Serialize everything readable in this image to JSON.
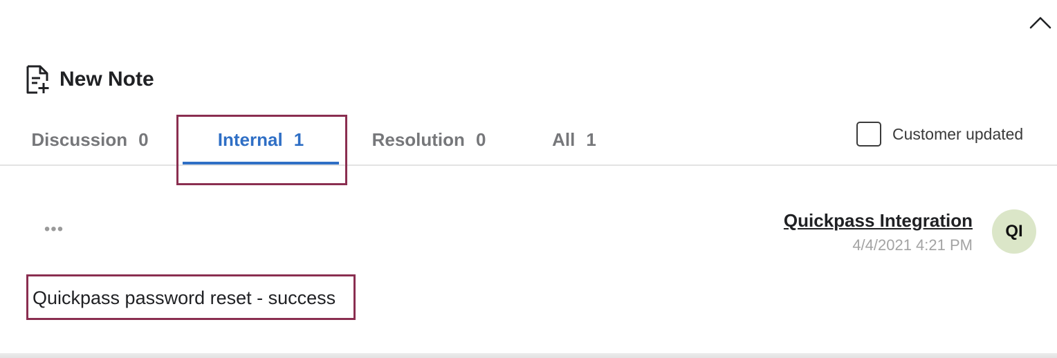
{
  "header": {
    "collapse_icon": "chevron-up-icon",
    "new_note_icon": "note-add-icon",
    "new_note_label": "New Note"
  },
  "tabs": [
    {
      "label": "Discussion",
      "count": "0",
      "active": false
    },
    {
      "label": "Internal",
      "count": "1",
      "active": true
    },
    {
      "label": "Resolution",
      "count": "0",
      "active": false
    },
    {
      "label": "All",
      "count": "1",
      "active": false
    }
  ],
  "customer_updated": {
    "label": "Customer updated",
    "checked": false
  },
  "note": {
    "more_icon": "more-horizontal-icon",
    "more_label": "•••",
    "author": "Quickpass Integration",
    "timestamp": "4/4/2021 4:21 PM",
    "avatar_initials": "QI",
    "text": "Quickpass password reset - success"
  },
  "colors": {
    "accent": "#2f6fc5",
    "highlight_border": "#8a2e50",
    "avatar_bg": "#dbe6c8",
    "inactive_tab": "#76777a"
  }
}
